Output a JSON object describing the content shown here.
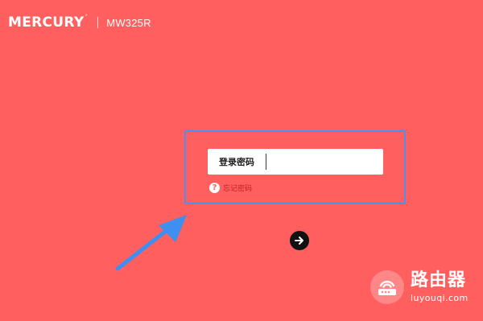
{
  "header": {
    "brand": "MERCURY",
    "brand_mark": "´",
    "model": "MW325R"
  },
  "login": {
    "password_label": "登录密码",
    "password_value": "",
    "forgot_label": "忘记密码",
    "help_icon_glyph": "?",
    "submit_icon": "arrow-right-icon"
  },
  "annotation": {
    "highlight_color": "#4b92f0",
    "arrow_color": "#3d8ff0"
  },
  "watermark": {
    "title": "路由器",
    "url": "luyouqi.com",
    "icon": "router-icon"
  },
  "colors": {
    "background": "#ff5f5f",
    "forgot_link": "#c41f1f"
  }
}
